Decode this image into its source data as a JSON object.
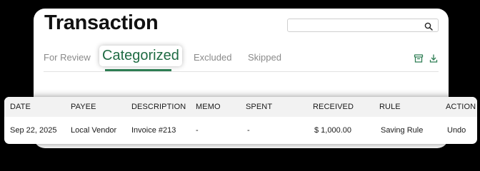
{
  "header": {
    "title": "Transaction",
    "search_value": ""
  },
  "tabs": [
    {
      "label": "For Review",
      "active": false
    },
    {
      "label": "Categorized",
      "active": true
    },
    {
      "label": "Excluded",
      "active": false
    },
    {
      "label": "Skipped",
      "active": false
    }
  ],
  "toolbar": {
    "icons": [
      "archive-icon",
      "download-icon"
    ]
  },
  "table": {
    "columns": [
      "DATE",
      "PAYEE",
      "DESCRIPTION",
      "MEMO",
      "SPENT",
      "RECEIVED",
      "RULE",
      "ACTION"
    ],
    "rows": [
      {
        "date": "Sep 22, 2025",
        "payee": "Local Vendor",
        "description": "Invoice #213",
        "memo": "-",
        "spent": "-",
        "received": "$ 1,000.00",
        "rule": "Saving Rule",
        "action": "Undo"
      }
    ]
  },
  "colors": {
    "accent_green": "#1f6b43",
    "underline_green": "#2e7d53",
    "icon_green": "#2e7d53",
    "page_background": "#000000",
    "header_row_background": "#f2f2f2"
  }
}
